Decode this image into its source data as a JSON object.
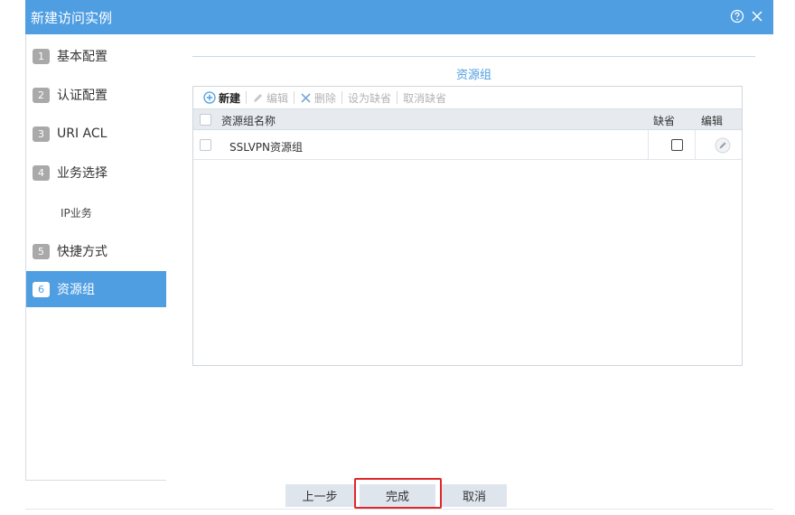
{
  "dialog": {
    "title": "新建访问实例",
    "help_icon": "help-circle-icon",
    "close_icon": "close-icon"
  },
  "steps": [
    {
      "num": "1",
      "label": "基本配置"
    },
    {
      "num": "2",
      "label": "认证配置"
    },
    {
      "num": "3",
      "label": "URI ACL"
    },
    {
      "num": "4",
      "label": "业务选择"
    },
    {
      "num": "5",
      "label": "快捷方式"
    },
    {
      "num": "6",
      "label": "资源组"
    }
  ],
  "substep": "IP业务",
  "section_title": "资源组",
  "toolbar": {
    "new_label": "新建",
    "edit_label": "编辑",
    "delete_label": "删除",
    "set_default_label": "设为缺省",
    "cancel_default_label": "取消缺省"
  },
  "table": {
    "columns": [
      "资源组名称",
      "缺省",
      "编辑"
    ],
    "rows": [
      {
        "name": "SSLVPN资源组",
        "default": false
      }
    ]
  },
  "buttons": {
    "prev": "上一步",
    "finish": "完成",
    "cancel": "取消"
  },
  "colors": {
    "accent": "#4f9ee2",
    "highlight": "#e0262b",
    "button_bg": "#dfe5ed"
  }
}
